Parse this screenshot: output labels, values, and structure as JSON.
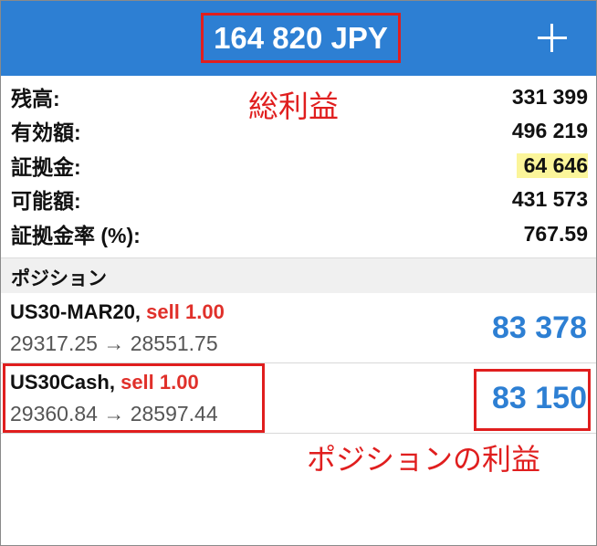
{
  "header": {
    "total_profit": "164 820 JPY",
    "add_label": "+"
  },
  "summary": [
    {
      "label": "残高:",
      "value": "331 399"
    },
    {
      "label": "有効額:",
      "value": "496 219"
    },
    {
      "label": "証拠金:",
      "value": "64 646"
    },
    {
      "label": "可能額:",
      "value": "431 573"
    },
    {
      "label": "証拠金率 (%):",
      "value": "767.59"
    }
  ],
  "annotations": {
    "total": "総利益",
    "position_profit": "ポジションの利益"
  },
  "positions_section": {
    "title": "ポジション"
  },
  "positions": [
    {
      "symbol": "US30-MAR20,",
      "side": "sell 1.00",
      "prices": "29317.25 → 28551.75",
      "profit": "83 378"
    },
    {
      "symbol": "US30Cash,",
      "side": "sell 1.00",
      "prices": "29360.84 → 28597.44",
      "profit": "83 150"
    }
  ],
  "colors": {
    "header_bg": "#2d7fd3",
    "profit": "#2d7fd3",
    "sell": "#e0302a",
    "highlight": "#fbf59a",
    "annotation": "#e01e1e"
  }
}
